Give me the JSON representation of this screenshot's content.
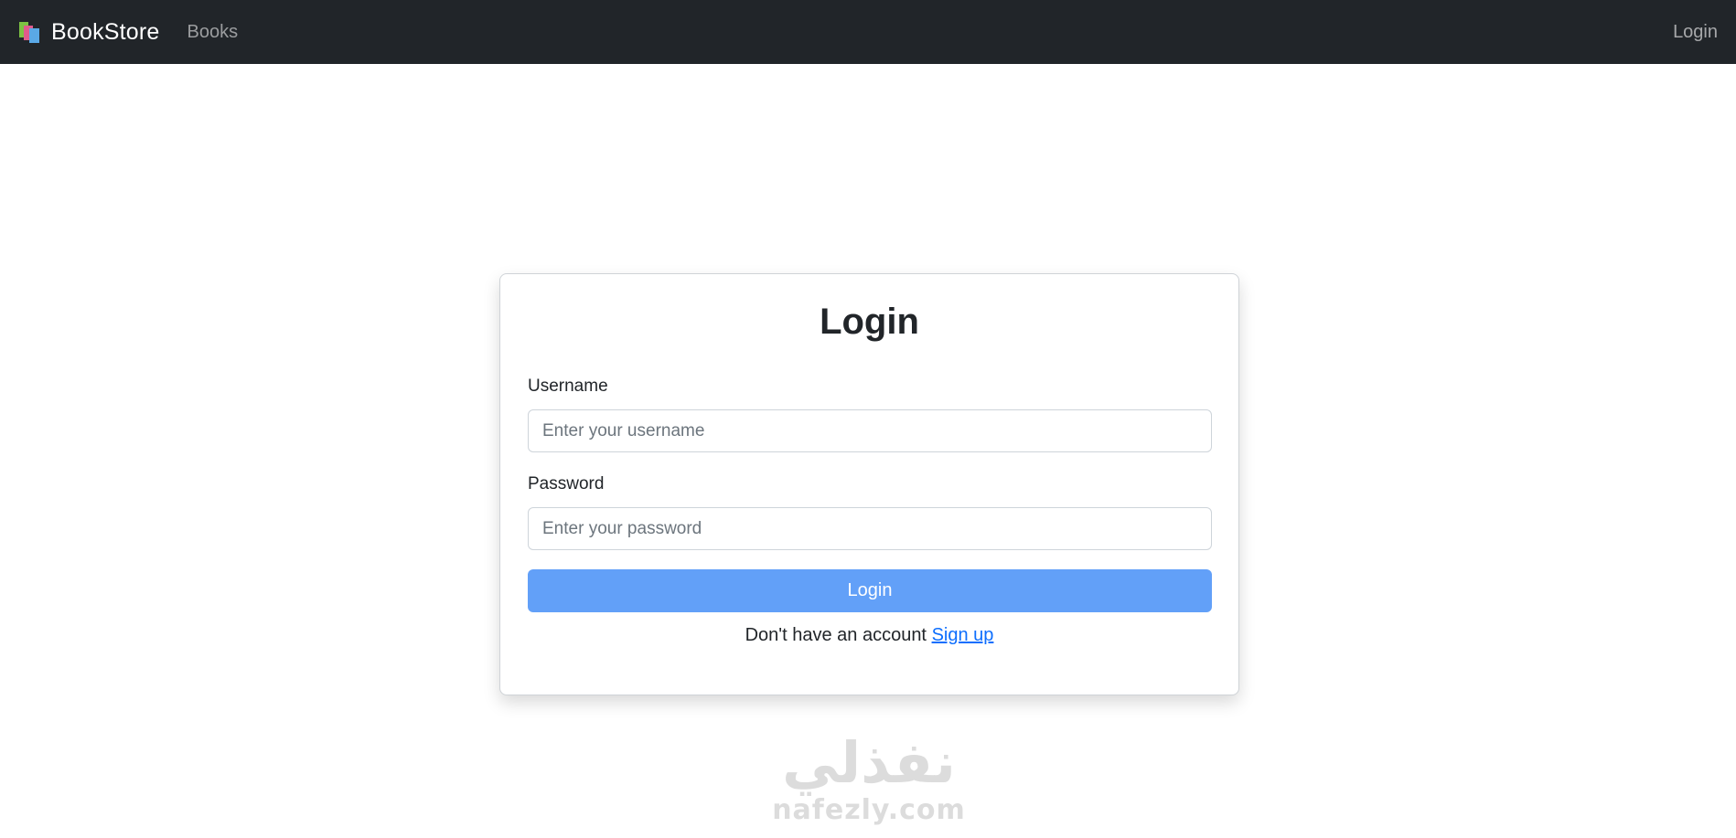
{
  "navbar": {
    "brand": "BookStore",
    "brand_icon": "books-icon",
    "links": [
      {
        "label": "Books"
      }
    ],
    "right_link": "Login",
    "background": "#212529"
  },
  "login_card": {
    "title": "Login",
    "username": {
      "label": "Username",
      "placeholder": "Enter your username",
      "value": ""
    },
    "password": {
      "label": "Password",
      "placeholder": "Enter your password",
      "value": ""
    },
    "submit_label": "Login",
    "submit_color": "#62a0f8",
    "signup_prompt": "Don't have an account",
    "signup_link": "Sign up",
    "link_color": "#0d6efd"
  },
  "watermark": {
    "arabic": "نفذلي",
    "latin": "nafezly.com"
  }
}
